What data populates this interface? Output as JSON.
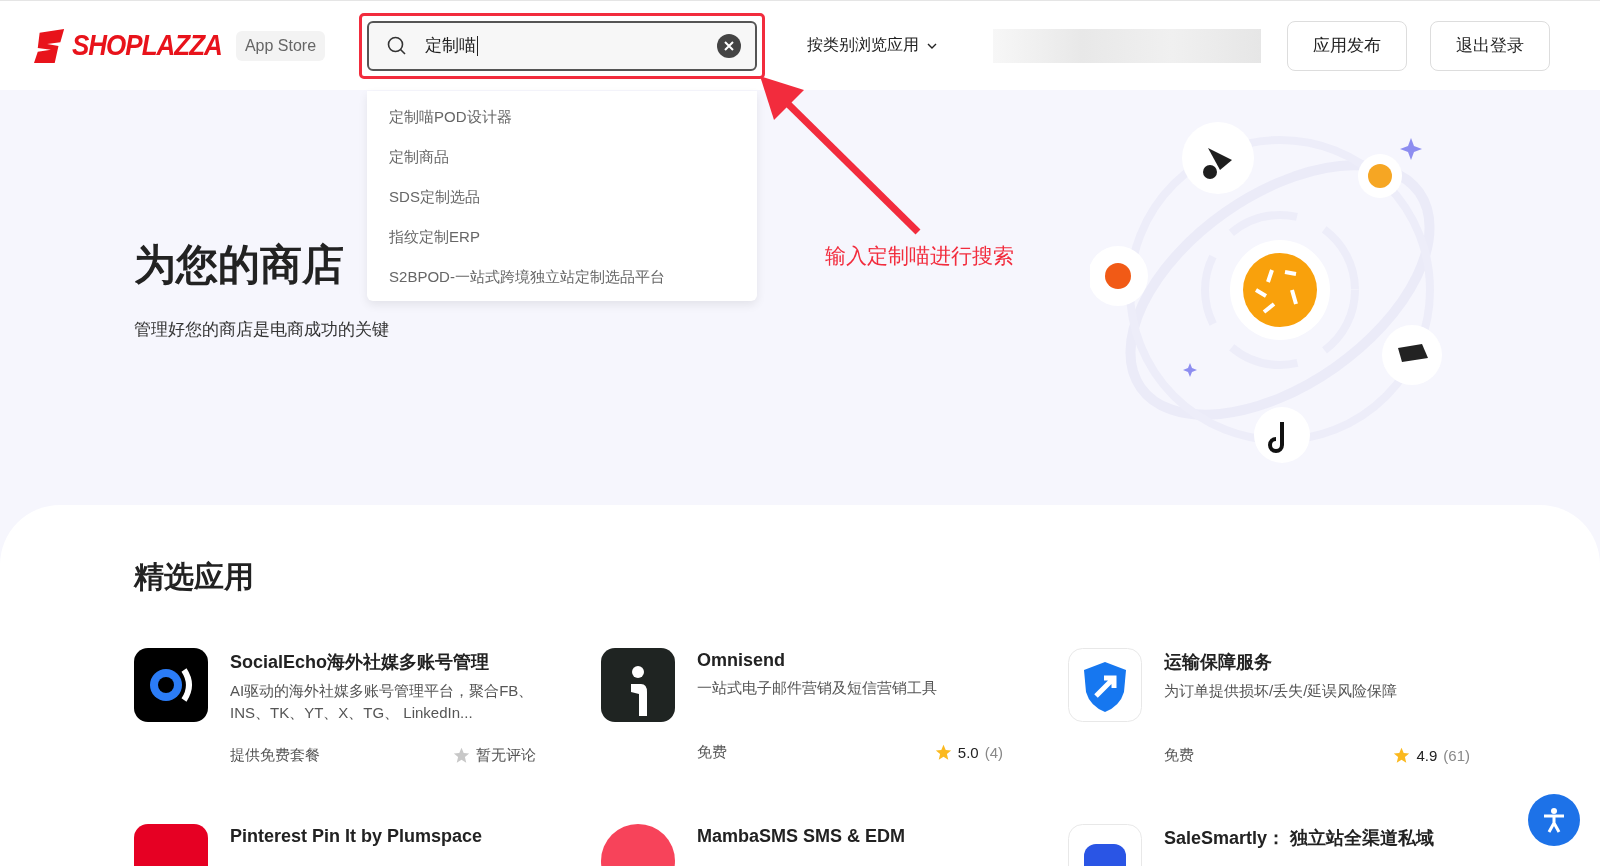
{
  "header": {
    "logo_text": "SHOPLAZZA",
    "badge": "App Store",
    "search": {
      "value": "定制喵"
    },
    "suggestions": [
      "定制喵POD设计器",
      "定制商品",
      "SDS定制选品",
      "指纹定制ERP",
      "S2BPOD-一站式跨境独立站定制选品平台"
    ],
    "nav_menu": "按类别浏览应用",
    "buttons": [
      "应用发布",
      "退出登录"
    ]
  },
  "hero": {
    "title": "为您的商店",
    "subtitle": "管理好您的商店是电商成功的关键"
  },
  "annotation": {
    "text": "输入定制喵进行搜索"
  },
  "featured": {
    "title": "精选应用",
    "apps": [
      {
        "name": "SocialEcho海外社媒多账号管理",
        "description": "AI驱动的海外社媒多账号管理平台，聚合FB、INS、TK、YT、X、TG、 LinkedIn...",
        "pricing": "提供免费套餐",
        "rating": {
          "kind": "none",
          "label": "暂无评论"
        }
      },
      {
        "name": "Omnisend",
        "description": "一站式电子邮件营销及短信营销工具",
        "pricing": "免费",
        "rating": {
          "kind": "score",
          "value": "5.0",
          "count": "(4)"
        }
      },
      {
        "name": "运输保障服务",
        "description": "为订单提供损坏/丢失/延误风险保障",
        "pricing": "免费",
        "rating": {
          "kind": "score",
          "value": "4.9",
          "count": "(61)"
        }
      },
      {
        "name": "Pinterest Pin It by Plumspace"
      },
      {
        "name": "MambaSMS SMS & EDM"
      },
      {
        "name": "SaleSmartly： 独立站全渠道私域"
      }
    ]
  }
}
